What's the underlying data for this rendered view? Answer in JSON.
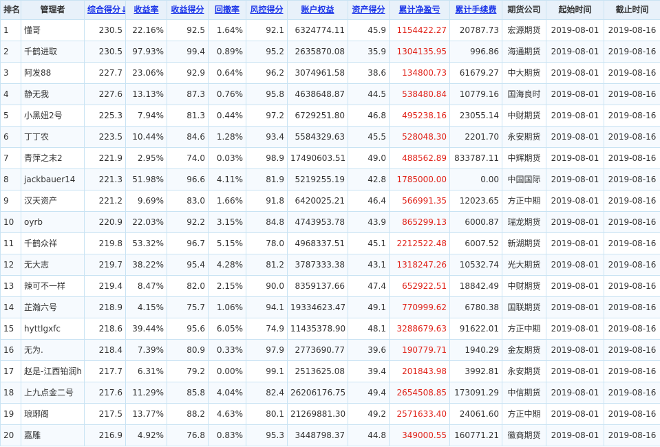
{
  "headers": [
    {
      "label": "排名",
      "sortable": false
    },
    {
      "label": "管理者",
      "sortable": false
    },
    {
      "label": "综合得分↓",
      "sortable": true
    },
    {
      "label": "收益率",
      "sortable": true
    },
    {
      "label": "收益得分",
      "sortable": true
    },
    {
      "label": "回撤率",
      "sortable": true
    },
    {
      "label": "风控得分",
      "sortable": true
    },
    {
      "label": "账户权益",
      "sortable": true
    },
    {
      "label": "资产得分",
      "sortable": true
    },
    {
      "label": "累计净盈亏",
      "sortable": true
    },
    {
      "label": "累计手续费",
      "sortable": true
    },
    {
      "label": "期货公司",
      "sortable": false
    },
    {
      "label": "起始时间",
      "sortable": false
    },
    {
      "label": "截止时间",
      "sortable": false
    }
  ],
  "colors": {
    "link": "#1a34e8",
    "profit": "#e0231a",
    "border": "#c9e3f3",
    "header_bg": "#e8f1fa"
  },
  "rows": [
    [
      "1",
      "懂哥",
      "230.5",
      "22.16%",
      "92.5",
      "1.64%",
      "92.1",
      "6324774.11",
      "45.9",
      "1154422.27",
      "20787.73",
      "宏源期货",
      "2019-08-01",
      "2019-08-16"
    ],
    [
      "2",
      "千鹤进取",
      "230.5",
      "97.93%",
      "99.4",
      "0.89%",
      "95.2",
      "2635870.08",
      "35.9",
      "1304135.95",
      "996.86",
      "海通期货",
      "2019-08-01",
      "2019-08-16"
    ],
    [
      "3",
      "阿发88",
      "227.7",
      "23.06%",
      "92.9",
      "0.64%",
      "96.2",
      "3074961.58",
      "38.6",
      "134800.73",
      "61679.27",
      "中大期货",
      "2019-08-01",
      "2019-08-16"
    ],
    [
      "4",
      "静无我",
      "227.6",
      "13.13%",
      "87.3",
      "0.76%",
      "95.8",
      "4638648.87",
      "44.5",
      "538480.84",
      "10779.16",
      "国海良时",
      "2019-08-01",
      "2019-08-16"
    ],
    [
      "5",
      "小黑妞2号",
      "225.3",
      "7.94%",
      "81.3",
      "0.44%",
      "97.2",
      "6729251.80",
      "46.8",
      "495238.16",
      "23055.14",
      "中财期货",
      "2019-08-01",
      "2019-08-16"
    ],
    [
      "6",
      "丁丁农",
      "223.5",
      "10.44%",
      "84.6",
      "1.28%",
      "93.4",
      "5584329.63",
      "45.5",
      "528048.30",
      "2201.70",
      "永安期货",
      "2019-08-01",
      "2019-08-16"
    ],
    [
      "7",
      "青萍之末2",
      "221.9",
      "2.95%",
      "74.0",
      "0.03%",
      "98.9",
      "17490603.51",
      "49.0",
      "488562.89",
      "833787.11",
      "中辉期货",
      "2019-08-01",
      "2019-08-16"
    ],
    [
      "8",
      "jackbauer14",
      "221.3",
      "51.98%",
      "96.6",
      "4.11%",
      "81.9",
      "5219255.19",
      "42.8",
      "1785000.00",
      "0.00",
      "中国国际",
      "2019-08-01",
      "2019-08-16"
    ],
    [
      "9",
      "汉天资产",
      "221.2",
      "9.69%",
      "83.0",
      "1.66%",
      "91.8",
      "6420025.21",
      "46.4",
      "566991.35",
      "12023.65",
      "方正中期",
      "2019-08-01",
      "2019-08-16"
    ],
    [
      "10",
      "oyrb",
      "220.9",
      "22.03%",
      "92.2",
      "3.15%",
      "84.8",
      "4743953.78",
      "43.9",
      "865299.13",
      "6000.87",
      "瑞龙期货",
      "2019-08-01",
      "2019-08-16"
    ],
    [
      "11",
      "千鹤众祥",
      "219.8",
      "53.32%",
      "96.7",
      "5.15%",
      "78.0",
      "4968337.51",
      "45.1",
      "2212522.48",
      "6007.52",
      "新湖期货",
      "2019-08-01",
      "2019-08-16"
    ],
    [
      "12",
      "无大志",
      "219.7",
      "38.22%",
      "95.4",
      "4.28%",
      "81.2",
      "3787333.38",
      "43.1",
      "1318247.26",
      "10532.74",
      "光大期货",
      "2019-08-01",
      "2019-08-16"
    ],
    [
      "13",
      "辣可不一样",
      "219.4",
      "8.47%",
      "82.0",
      "2.15%",
      "90.0",
      "8359137.66",
      "47.4",
      "652922.51",
      "18842.49",
      "中财期货",
      "2019-08-01",
      "2019-08-16"
    ],
    [
      "14",
      "芷瀚六号",
      "218.9",
      "4.15%",
      "75.7",
      "1.06%",
      "94.1",
      "19334623.47",
      "49.1",
      "770999.62",
      "6780.38",
      "国联期货",
      "2019-08-01",
      "2019-08-16"
    ],
    [
      "15",
      "hyttlgxfc",
      "218.6",
      "39.44%",
      "95.6",
      "6.05%",
      "74.9",
      "11435378.90",
      "48.1",
      "3288679.63",
      "91622.01",
      "方正中期",
      "2019-08-01",
      "2019-08-16"
    ],
    [
      "16",
      "无为.",
      "218.4",
      "7.39%",
      "80.9",
      "0.33%",
      "97.9",
      "2773690.77",
      "39.6",
      "190779.71",
      "1940.29",
      "金友期货",
      "2019-08-01",
      "2019-08-16"
    ],
    [
      "17",
      "赵是-江西铂润h",
      "217.7",
      "6.31%",
      "79.2",
      "0.00%",
      "99.1",
      "2513625.08",
      "39.4",
      "201843.98",
      "3992.81",
      "永安期货",
      "2019-08-01",
      "2019-08-16"
    ],
    [
      "18",
      "上九点金二号",
      "217.6",
      "11.29%",
      "85.8",
      "4.04%",
      "82.4",
      "26206176.75",
      "49.4",
      "2654508.85",
      "173091.29",
      "中信期货",
      "2019-08-01",
      "2019-08-16"
    ],
    [
      "19",
      "琅琊阁",
      "217.5",
      "13.77%",
      "88.2",
      "4.63%",
      "80.1",
      "21269881.30",
      "49.2",
      "2571633.40",
      "24061.60",
      "方正中期",
      "2019-08-01",
      "2019-08-16"
    ],
    [
      "20",
      "嘉雕",
      "216.9",
      "4.92%",
      "76.8",
      "0.83%",
      "95.3",
      "3448798.37",
      "44.8",
      "349000.55",
      "160771.21",
      "徽商期货",
      "2019-08-01",
      "2019-08-16"
    ]
  ]
}
